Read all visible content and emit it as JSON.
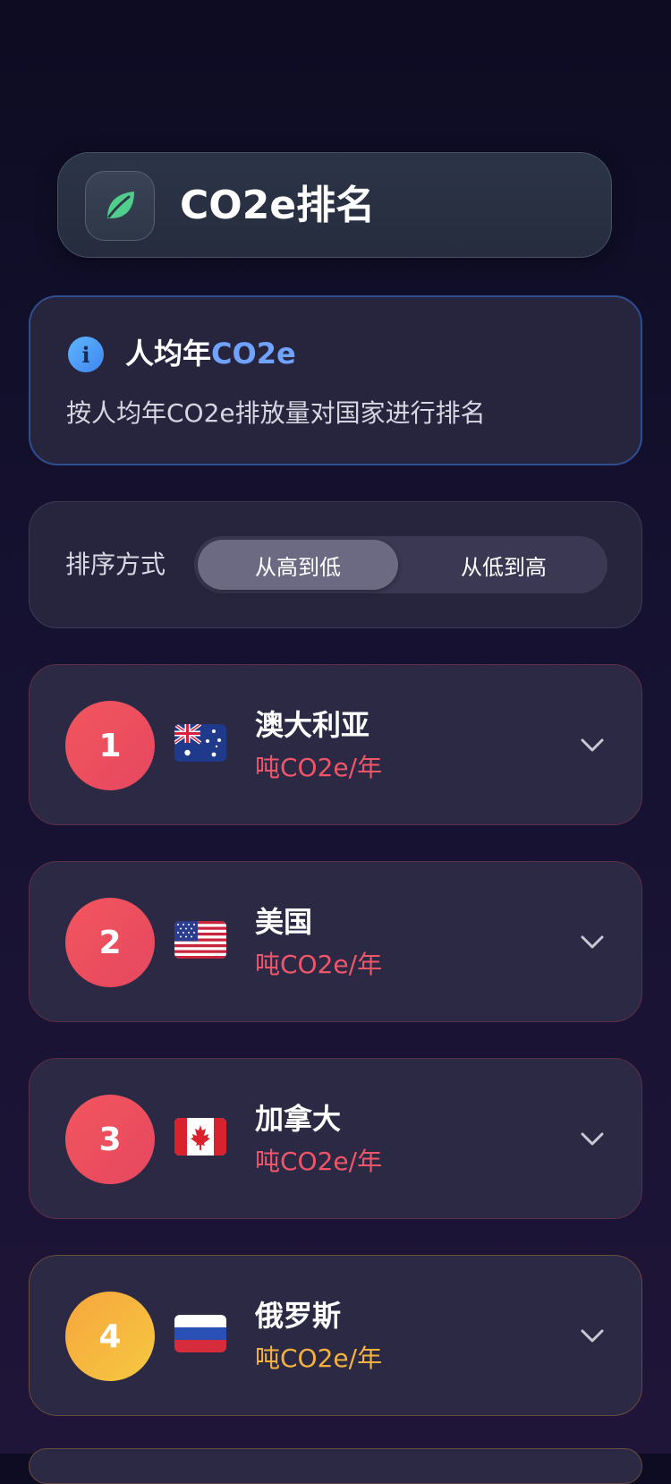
{
  "header": {
    "icon": "leaf-icon",
    "title": "CO2e排名"
  },
  "info": {
    "icon": "info-icon",
    "icon_glyph": "i",
    "title_prefix": "人均年",
    "title_highlight": "CO2e",
    "description": "按人均年CO2e排放量对国家进行排名"
  },
  "sort": {
    "label": "排序方式",
    "options": [
      {
        "label": "从高到低",
        "selected": true
      },
      {
        "label": "从低到高",
        "selected": false
      }
    ]
  },
  "countries": [
    {
      "rank": "1",
      "name": "澳大利亚",
      "unit": "吨CO2e/年",
      "flag": "australia-flag-icon",
      "badge_color": "#ef505f"
    },
    {
      "rank": "2",
      "name": "美国",
      "unit": "吨CO2e/年",
      "flag": "usa-flag-icon",
      "badge_color": "#ef505f"
    },
    {
      "rank": "3",
      "name": "加拿大",
      "unit": "吨CO2e/年",
      "flag": "canada-flag-icon",
      "badge_color": "#ef505f"
    },
    {
      "rank": "4",
      "name": "俄罗斯",
      "unit": "吨CO2e/年",
      "flag": "russia-flag-icon",
      "badge_color": "#f6b23f"
    }
  ],
  "colors": {
    "accent_blue": "#6fa3ff",
    "red_unit": "#f0566a",
    "gold_unit": "#f6b23f",
    "leaf_green": "#4fce8c"
  }
}
